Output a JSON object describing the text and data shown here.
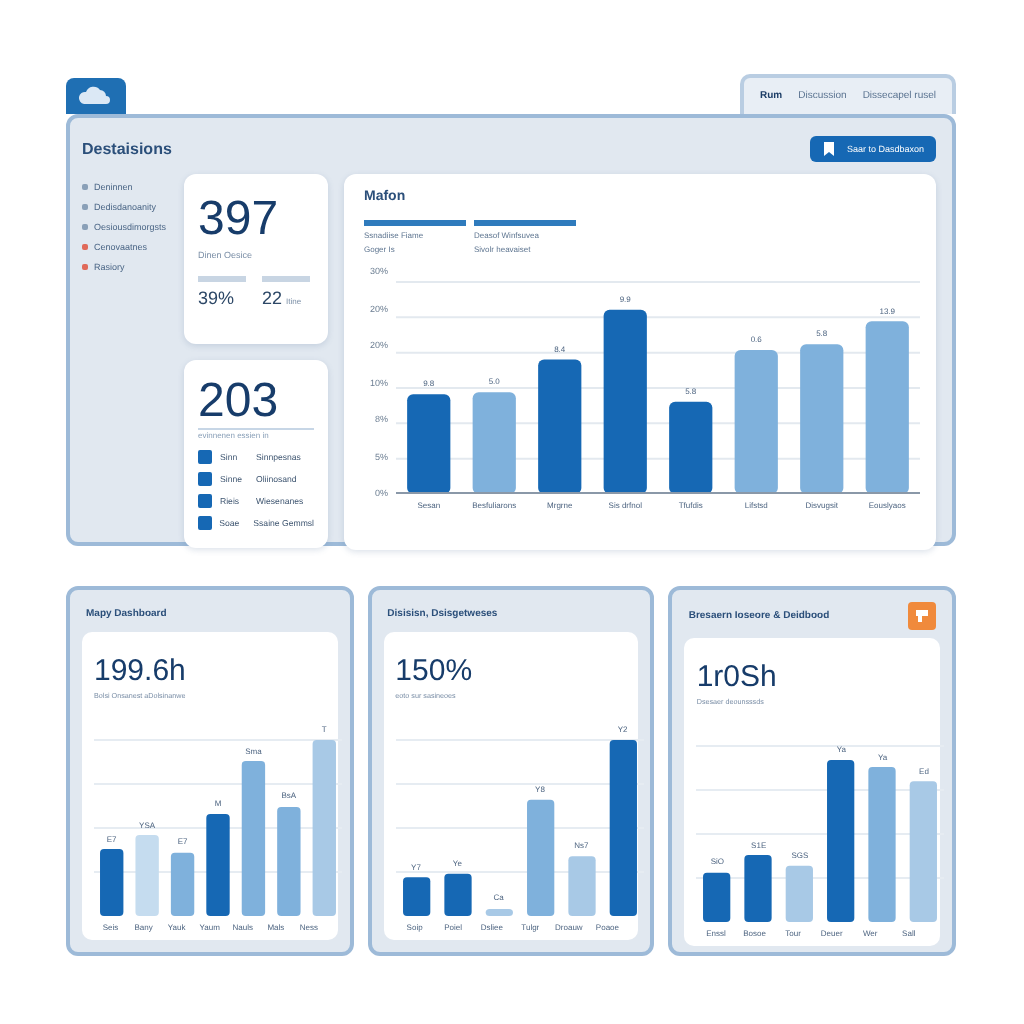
{
  "top_tabs": [
    {
      "label": "Rum",
      "selected": true
    },
    {
      "label": "Discussion",
      "selected": false
    },
    {
      "label": "Dissecapel rusel",
      "selected": false
    }
  ],
  "header": {
    "title": "Destaisions",
    "button": "Saar to Dasdbaxon"
  },
  "sidebar": [
    {
      "label": "Deninnen",
      "color": "#8aa0b8"
    },
    {
      "label": "Dedisdanoanity",
      "color": "#8aa0b8"
    },
    {
      "label": "Oesiousdimorgsts",
      "color": "#8aa0b8"
    },
    {
      "label": "Cenovaatnes",
      "color": "#e06a5a"
    },
    {
      "label": "Rasiory",
      "color": "#e06a5a"
    }
  ],
  "stat_card": {
    "value": "397",
    "caption": "Dinen Oesice",
    "metrics": [
      {
        "value": "39%"
      },
      {
        "value": "22",
        "unit": "Itine"
      }
    ]
  },
  "task_card": {
    "value": "203",
    "caption": "evinnenen essien in",
    "rows": [
      {
        "checked": true,
        "label": "Sinn",
        "detail": "Sinnpesnas"
      },
      {
        "checked": true,
        "label": "Sinne",
        "detail": "Oliinosand"
      },
      {
        "checked": true,
        "label": "Rieis",
        "detail": "Wiesenanes"
      },
      {
        "checked": true,
        "label": "Soae",
        "detail": "Ssaine Gemmsl"
      }
    ]
  },
  "main_chart": {
    "title": "Mafon",
    "legend": [
      {
        "line1": "Ssnadiise Fiame",
        "line2": "Goger Is"
      },
      {
        "line1": "Deasof Winfsuvea",
        "line2": "Sivolr heavaiset"
      }
    ],
    "y_axis_labels": [
      "30%",
      "20%",
      "20%",
      "10%",
      "8%",
      "5%",
      "0%"
    ],
    "bars": [
      {
        "label": "Sesan",
        "note": "9.8",
        "color": "#1668b4"
      },
      {
        "label": "Besfuliarons",
        "note": "5.0",
        "color": "#7fb1dc"
      },
      {
        "label": "Mrgrne",
        "note": "8.4",
        "color": "#1668b4"
      },
      {
        "label": "Sis drfnol",
        "note": "9.9",
        "color": "#1668b4"
      },
      {
        "label": "Tfufdis",
        "note": "5.8",
        "color": "#1668b4"
      },
      {
        "label": "Lifstsd",
        "note": "0.6",
        "color": "#7fb1dc"
      },
      {
        "label": "Disvugsit",
        "note": "5.8",
        "color": "#7fb1dc"
      },
      {
        "label": "Eouslyaos",
        "note": "13.9",
        "color": "#7fb1dc"
      }
    ]
  },
  "panels": [
    {
      "title": "Mapy Dashboard",
      "value": "199.6h",
      "caption": "Bolsi Onsanest aDolsinanwe",
      "badge": false,
      "bars": [
        {
          "label": "Seis",
          "note": "E7",
          "color": "#1668b4"
        },
        {
          "label": "Bany",
          "note": "YSA",
          "color": "#c5dcef"
        },
        {
          "label": "Yauk",
          "note": "E7",
          "color": "#7fb1dc"
        },
        {
          "label": "Yaum",
          "note": "M",
          "color": "#1668b4"
        },
        {
          "label": "Nauls",
          "note": "Sma",
          "color": "#7fb1dc"
        },
        {
          "label": "Mals",
          "note": "BsA",
          "color": "#7fb1dc"
        },
        {
          "label": "Ness",
          "note": "T",
          "color": "#a8c9e6"
        }
      ]
    },
    {
      "title": "Disisisn, Dsisgetweses",
      "value": "150%",
      "caption": "eoto sur sasineoes",
      "badge": false,
      "bars": [
        {
          "label": "Soip",
          "note": "Y7",
          "color": "#1668b4"
        },
        {
          "label": "Poiel",
          "note": "Ye",
          "color": "#1668b4"
        },
        {
          "label": "Dsliee",
          "note": "Ca",
          "color": "#a8c9e6"
        },
        {
          "label": "Tulgr",
          "note": "Y8",
          "color": "#7fb1dc"
        },
        {
          "label": "Droauw",
          "note": "Ns7",
          "color": "#a8c9e6"
        },
        {
          "label": "Poaoe",
          "note": "Y2",
          "color": "#1668b4"
        }
      ]
    },
    {
      "title": "Bresaern Ioseore & Deidbood",
      "value": "1r0Sh",
      "caption": "Dsesaer deounsssds",
      "badge": true,
      "bars": [
        {
          "label": "Enssl",
          "note": "SiO",
          "color": "#1668b4"
        },
        {
          "label": "Bosoe",
          "note": "S1E",
          "color": "#1668b4"
        },
        {
          "label": "Tour",
          "note": "SGS",
          "color": "#a8c9e6"
        },
        {
          "label": "Deuer",
          "note": "Ya",
          "color": "#1668b4"
        },
        {
          "label": "Wer",
          "note": "Ya",
          "color": "#7fb1dc"
        },
        {
          "label": "Sall",
          "note": "Ed",
          "color": "#a8c9e6"
        }
      ]
    }
  ]
}
